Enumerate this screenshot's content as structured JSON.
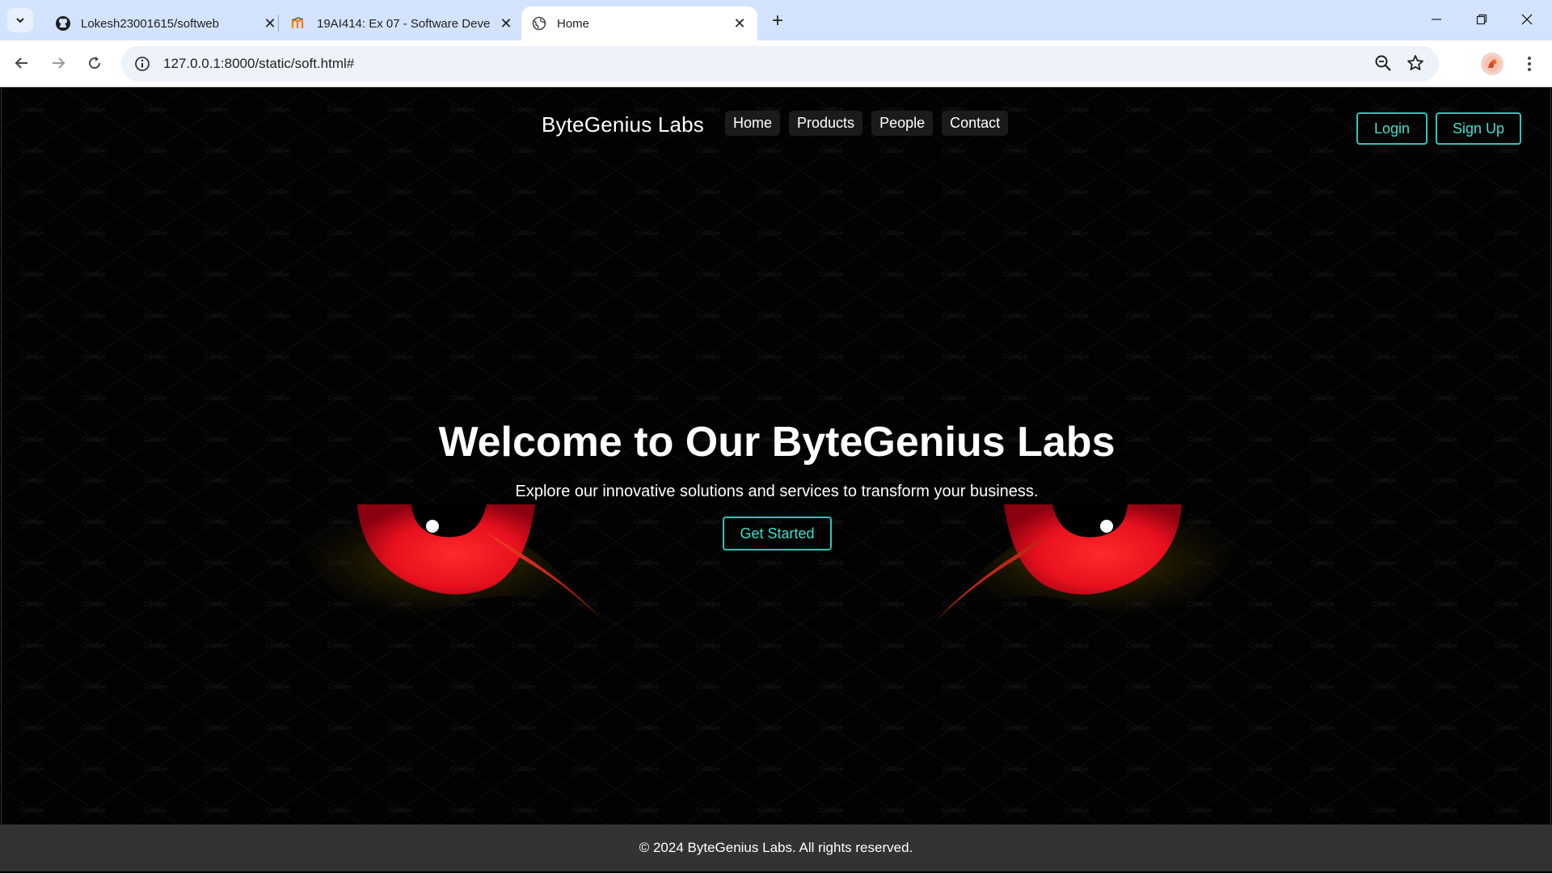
{
  "browser": {
    "tabs": [
      {
        "title": "Lokesh23001615/softweb",
        "favicon": "github-icon",
        "active": false
      },
      {
        "title": "19AI414: Ex 07 - Software Deve",
        "favicon": "moodle-icon",
        "active": false
      },
      {
        "title": "Home",
        "favicon": "globe-icon",
        "active": true
      }
    ],
    "url": "127.0.0.1:8000/static/soft.html#"
  },
  "site": {
    "brand": "ByteGenius Labs",
    "nav": [
      "Home",
      "Products",
      "People",
      "Contact"
    ],
    "login_label": "Login",
    "signup_label": "Sign Up",
    "headline": "Welcome to Our ByteGenius Labs",
    "subline": "Explore our innovative solutions and services to transform your business.",
    "cta_label": "Get Started",
    "footer": "© 2024 ByteGenius Labs. All rights reserved.",
    "accent_color": "#2fc5b8",
    "background_image": "glowing-red-cat-eyes",
    "watermark_text": "Creative"
  }
}
